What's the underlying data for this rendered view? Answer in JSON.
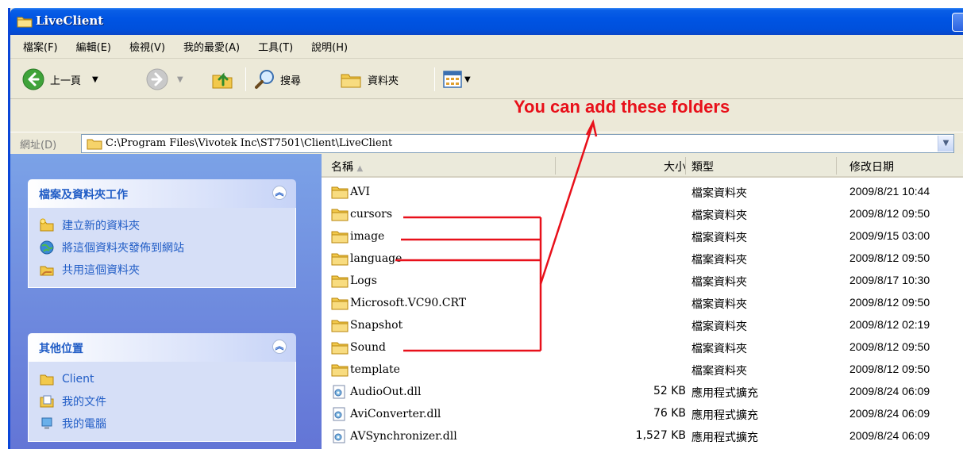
{
  "window": {
    "title": "LiveClient"
  },
  "menu": [
    "檔案(F)",
    "編輯(E)",
    "檢視(V)",
    "我的最愛(A)",
    "工具(T)",
    "說明(H)"
  ],
  "toolbar": {
    "back_label": "上一頁",
    "search_label": "搜尋",
    "folders_label": "資料夾"
  },
  "annotation": {
    "text": "You can add these folders",
    "color": "#e8101a"
  },
  "address": {
    "label": "網址(D)",
    "path": "C:\\Program Files\\Vivotek Inc\\ST7501\\Client\\LiveClient"
  },
  "tasks_panel": {
    "title": "檔案及資料夾工作",
    "items": [
      {
        "label": "建立新的資料夾",
        "icon": "new-folder-icon"
      },
      {
        "label": "將這個資料夾發佈到網站",
        "icon": "publish-web-icon"
      },
      {
        "label": "共用這個資料夾",
        "icon": "share-folder-icon"
      }
    ]
  },
  "places_panel": {
    "title": "其他位置",
    "items": [
      {
        "label": "Client",
        "icon": "folder-icon"
      },
      {
        "label": "我的文件",
        "icon": "my-documents-icon"
      },
      {
        "label": "我的電腦",
        "icon": "my-computer-icon"
      }
    ]
  },
  "columns": {
    "name": "名稱",
    "size": "大小",
    "type": "類型",
    "date": "修改日期"
  },
  "files": [
    {
      "name": "AVI",
      "size": "",
      "type": "檔案資料夾",
      "date": "2009/8/21 10:44",
      "icon": "folder-icon"
    },
    {
      "name": "cursors",
      "size": "",
      "type": "檔案資料夾",
      "date": "2009/8/12 09:50",
      "icon": "folder-icon"
    },
    {
      "name": "image",
      "size": "",
      "type": "檔案資料夾",
      "date": "2009/9/15 03:00",
      "icon": "folder-icon"
    },
    {
      "name": "language",
      "size": "",
      "type": "檔案資料夾",
      "date": "2009/8/12 09:50",
      "icon": "folder-icon"
    },
    {
      "name": "Logs",
      "size": "",
      "type": "檔案資料夾",
      "date": "2009/8/17 10:30",
      "icon": "folder-icon"
    },
    {
      "name": "Microsoft.VC90.CRT",
      "size": "",
      "type": "檔案資料夾",
      "date": "2009/8/12 09:50",
      "icon": "folder-icon"
    },
    {
      "name": "Snapshot",
      "size": "",
      "type": "檔案資料夾",
      "date": "2009/8/12 02:19",
      "icon": "folder-icon"
    },
    {
      "name": "Sound",
      "size": "",
      "type": "檔案資料夾",
      "date": "2009/8/12 09:50",
      "icon": "folder-icon"
    },
    {
      "name": "template",
      "size": "",
      "type": "檔案資料夾",
      "date": "2009/8/12 09:50",
      "icon": "folder-icon"
    },
    {
      "name": "AudioOut.dll",
      "size": "52 KB",
      "type": "應用程式擴充",
      "date": "2009/8/24 06:09",
      "icon": "dll-icon"
    },
    {
      "name": "AviConverter.dll",
      "size": "76 KB",
      "type": "應用程式擴充",
      "date": "2009/8/24 06:09",
      "icon": "dll-icon"
    },
    {
      "name": "AVSynchronizer.dll",
      "size": "1,527 KB",
      "type": "應用程式擴充",
      "date": "2009/8/24 06:09",
      "icon": "dll-icon"
    }
  ]
}
